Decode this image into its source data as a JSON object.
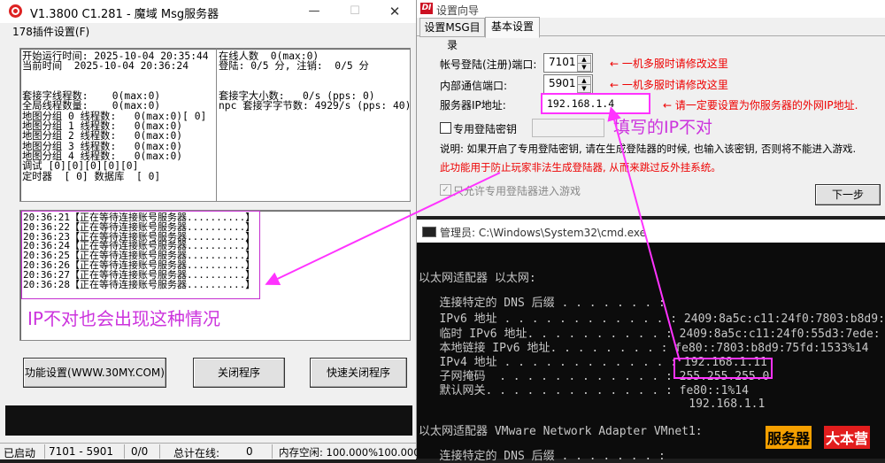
{
  "msg_window": {
    "title": "V1.3800 C1.281 - 魔域 Msg服务器",
    "menu": "178插件设置(F)",
    "status_left": [
      "开始运行时间: 2025-10-04 20:35:44",
      "当前时间  2025-10-04 20:36:24",
      "",
      "",
      "套接字线程数:    0(max:0)",
      "全局线程数量:    0(max:0)",
      "地图分组 0 线程数:   0(max:0)[ 0]",
      "地图分组 1 线程数:   0(max:0)",
      "地图分组 2 线程数:   0(max:0)",
      "地图分组 3 线程数:   0(max:0)",
      "地图分组 4 线程数:   0(max:0)",
      "调试 [0][0][0][0][0]",
      "定时器  [ 0] 数据库  [ 0]"
    ],
    "status_right": [
      "在线人数  0(max:0)",
      "登陆: 0/5 分, 注销:  0/5 分",
      "",
      "",
      "套接字大小数:   0/s (pps: 0)",
      "npc 套接字字节数: 4929/s (pps: 40)"
    ],
    "log_lines": [
      "20:36:21【正在等待连接账号服务器..........】",
      "20:36:22【正在等待连接账号服务器..........】",
      "20:36:23【正在等待连接账号服务器..........】",
      "20:36:24【正在等待连接账号服务器..........】",
      "20:36:25【正在等待连接账号服务器..........】",
      "20:36:26【正在等待连接账号服务器..........】",
      "20:36:27【正在等待连接账号服务器..........】",
      "20:36:28【正在等待连接账号服务器..........】"
    ],
    "annotation": "IP不对也会出现这种情况",
    "buttons": {
      "settings": "功能设置(WWW.30MY.COM)",
      "close": "关闭程序",
      "quick_close": "快速关闭程序"
    },
    "statusbar": {
      "started": "已启动",
      "ports": "7101 - 5901",
      "ratio": "0/0",
      "online_label": "总计在线:",
      "online_value": "0",
      "memory": "内存空闲: 100.000%100.000%"
    }
  },
  "wizard": {
    "title": "设置向导",
    "logo": "DI",
    "tabs": [
      "设置MSG目录",
      "基本设置"
    ],
    "account_port_label": "帐号登陆(注册)端口:",
    "account_port_value": "7101",
    "internal_port_label": "内部通信端口:",
    "internal_port_value": "5901",
    "ip_label": "服务器IP地址:",
    "ip_value": "192.168.1.4",
    "note_port1": "← 一机多服时请修改这里",
    "note_port2": "← 一机多服时请修改这里",
    "note_ip": "← 请一定要设置为你服务器的外网IP地址.",
    "ip_annotation": "填写的IP不对",
    "private_key_label": "专用登陆密钥",
    "explain_line1": "说明: 如果开启了专用登陆密钥, 请在生成登陆器的时候, 也输入该密钥, 否则将不能进入游戏.",
    "explain_line2": "此功能用于防止玩家非法生成登陆器, 从而来跳过反外挂系统。",
    "only_private_label": "只允许专用登陆器进入游戏",
    "next_button": "下一步"
  },
  "cmd": {
    "title": "管理员: C:\\Windows\\System32\\cmd.exe",
    "lines": [
      "以太网适配器 以太网:",
      "   连接特定的 DNS 后缀 . . . . . . . :",
      "   IPv6 地址 . . . . . . . . . . . . : 2409:8a5c:c11:24f0:7803:b8d9:",
      "   临时 IPv6 地址. . . . . . . . . . : 2409:8a5c:c11:24f0:55d3:7ede:",
      "   本地链接 IPv6 地址. . . . . . . . : fe80::7803:b8d9:75fd:1533%14",
      "   IPv4 地址 . . . . . . . . . . . . : 192.168.1.11",
      "   子网掩码  . . . . . . . . . . . . : 255.255.255.0",
      "   默认网关. . . . . . . . . . . . . : fe80::1%14",
      "                                       192.168.1.1",
      "以太网适配器 VMware Network Adapter VMnet1:",
      "   连接特定的 DNS 后缀 . . . . . . . :"
    ],
    "watermark_a": "服务器",
    "watermark_b": "大本营"
  }
}
